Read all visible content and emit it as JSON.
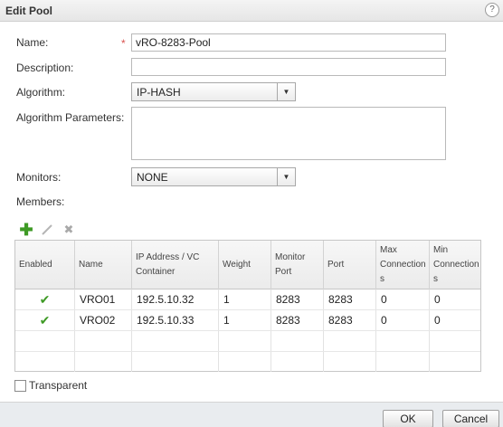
{
  "dialog": {
    "title": "Edit Pool",
    "help_glyph": "?"
  },
  "form": {
    "name_label": "Name:",
    "required_marker": "*",
    "name_value": "vRO-8283-Pool",
    "description_label": "Description:",
    "description_value": "",
    "algorithm_label": "Algorithm:",
    "algorithm_value": "IP-HASH",
    "algorithm_params_label": "Algorithm Parameters:",
    "algorithm_params_value": "",
    "monitors_label": "Monitors:",
    "monitors_value": "NONE",
    "members_label": "Members:"
  },
  "toolbar": {
    "icons": [
      "add-icon",
      "edit-icon",
      "delete-icon"
    ]
  },
  "members_table": {
    "columns": [
      "Enabled",
      "Name",
      "IP Address / VC Container",
      "Weight",
      "Monitor Port",
      "Port",
      "Max Connection s",
      "Min Connection s"
    ],
    "rows": [
      {
        "enabled": true,
        "name": "VRO01",
        "ip": "192.5.10.32",
        "weight": "1",
        "monitor_port": "8283",
        "port": "8283",
        "max_conn": "0",
        "min_conn": "0"
      },
      {
        "enabled": true,
        "name": "VRO02",
        "ip": "192.5.10.33",
        "weight": "1",
        "monitor_port": "8283",
        "port": "8283",
        "max_conn": "0",
        "min_conn": "0"
      }
    ]
  },
  "transparent": {
    "label": "Transparent",
    "checked": false
  },
  "buttons": {
    "ok": "OK",
    "cancel": "Cancel"
  },
  "colors": {
    "enabled_check": "#3e9a25",
    "add_icon": "#3e9a25",
    "required": "#d9534f"
  }
}
